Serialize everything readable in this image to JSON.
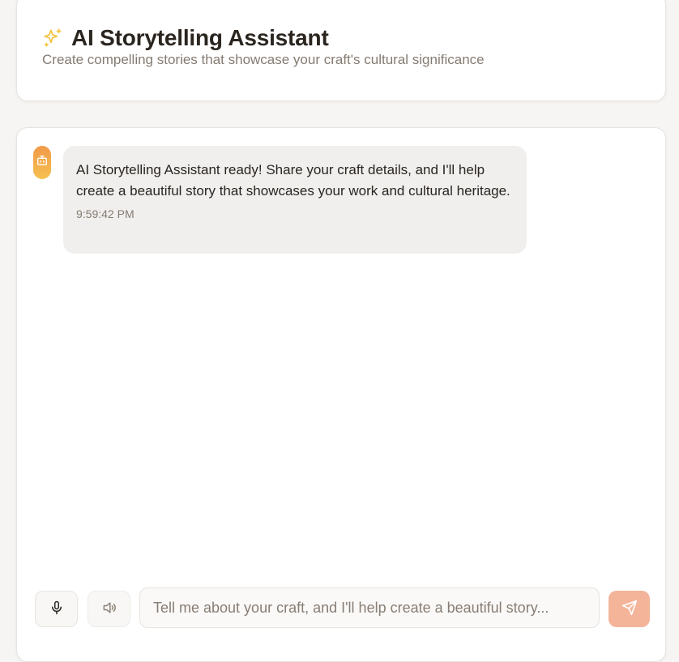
{
  "header": {
    "icon": "sparkles-icon",
    "icon_color": "#f4c542",
    "title": "AI Storytelling Assistant",
    "subtitle": "Create compelling stories that showcase your craft's cultural significance"
  },
  "chat": {
    "messages": [
      {
        "sender": "assistant",
        "avatar_icon": "bot-icon",
        "text": "AI Storytelling Assistant ready! Share your craft details, and I'll help create a beautiful story that showcases your work and cultural heritage.",
        "time": "9:59:42 PM"
      }
    ]
  },
  "composer": {
    "mic_icon": "microphone-icon",
    "speaker_icon": "speaker-icon",
    "placeholder": "Tell me about your craft, and I'll help create a beautiful story...",
    "value": "",
    "send_icon": "send-icon",
    "send_color": "#f4b49a"
  }
}
